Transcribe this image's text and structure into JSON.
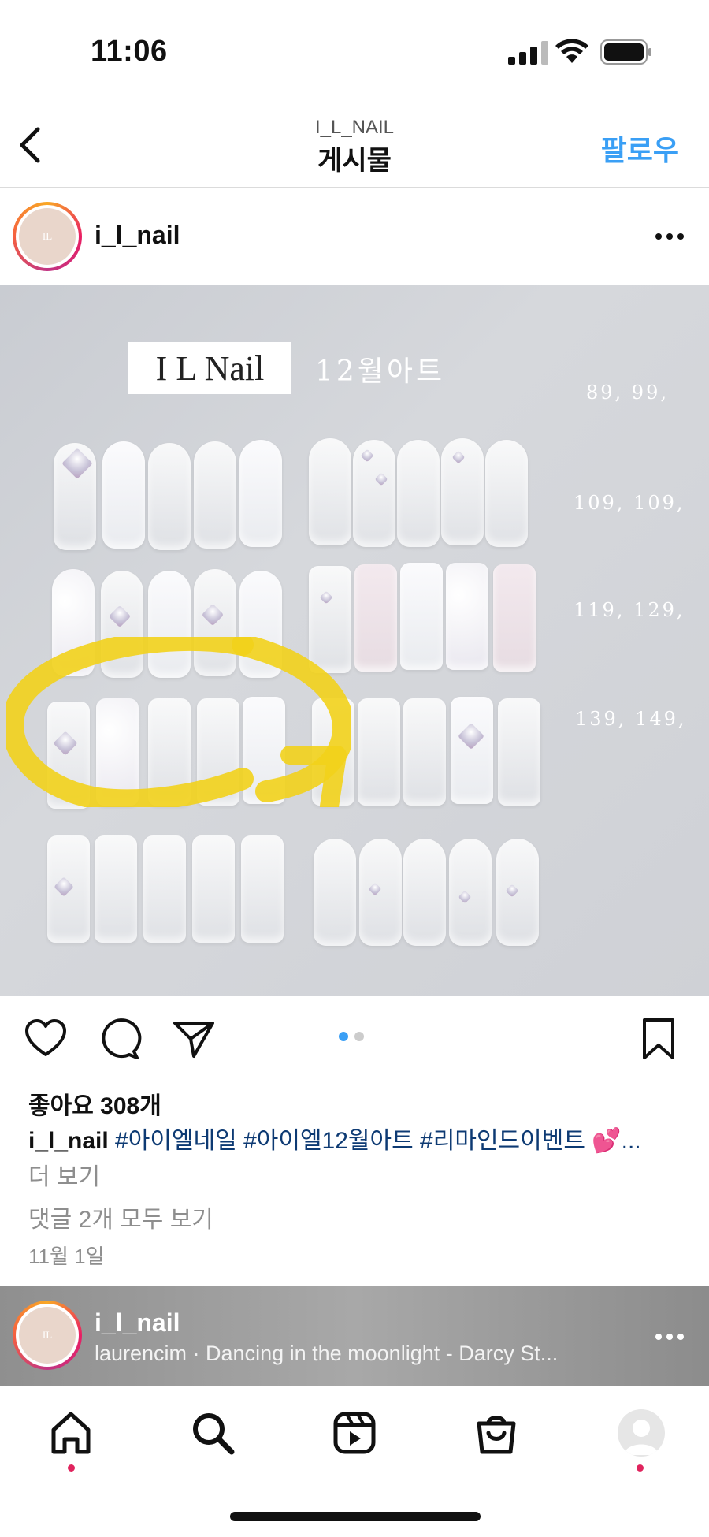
{
  "status_bar": {
    "time": "11:06"
  },
  "nav": {
    "account": "I_L_NAIL",
    "title": "게시물",
    "follow_label": "팔로우"
  },
  "post": {
    "username": "i_l_nail",
    "image": {
      "brand": "I L Nail",
      "month_label": "12월아트",
      "prices": [
        "89, 99,",
        "109, 109,",
        "119, 129,",
        "139, 149,"
      ]
    },
    "carousel": {
      "count": 2,
      "active": 0
    },
    "likes": "좋아요 308개",
    "caption_user": "i_l_nail",
    "caption_text": " #아이엘네일 #아이엘12월아트 #리마인드이벤트 💕...",
    "more_label": "더 보기",
    "comments_label": "댓글 2개 모두 보기",
    "date": "11월 1일"
  },
  "music_bar": {
    "username": "i_l_nail",
    "track": "laurencim · Dancing in the moonlight - Darcy St..."
  },
  "tab_bar": {
    "items": [
      "home-icon",
      "search-icon",
      "reels-icon",
      "shop-icon",
      "profile-icon"
    ]
  },
  "colors": {
    "accent": "#3a9ff5",
    "hashtag": "#0d3a73",
    "notification_dot": "#e0245e",
    "highlight": "#f2d21b"
  }
}
